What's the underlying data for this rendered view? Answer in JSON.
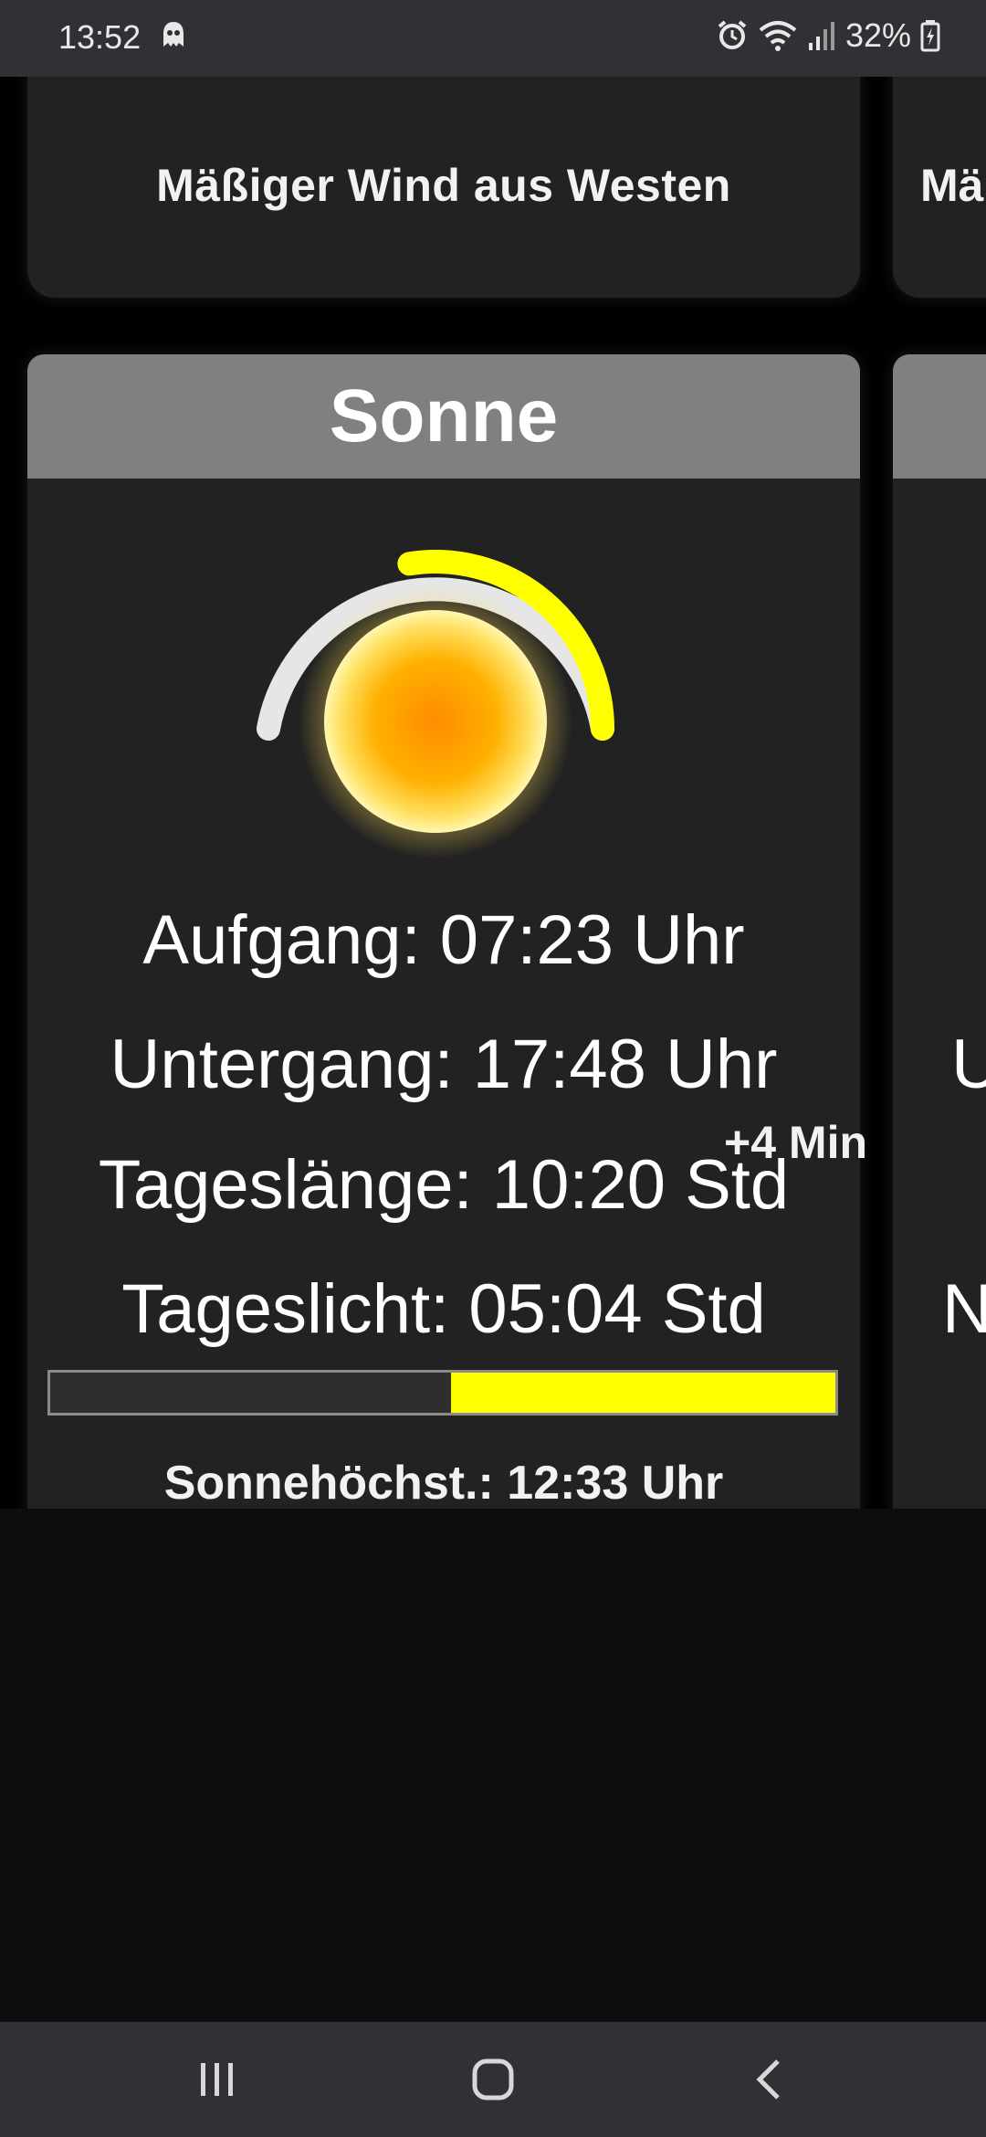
{
  "status_bar": {
    "time": "13:52",
    "battery": "32%"
  },
  "cards": {
    "wind": {
      "text": "Mäßiger Wind aus Westen",
      "peek_text": "Mä"
    },
    "sun": {
      "title": "Sonne",
      "sunrise": "Aufgang: 07:23 Uhr",
      "sunset": "Untergang: 17:48 Uhr",
      "delta": "+4 Min",
      "day_length": "Tageslänge: 10:20 Std",
      "daylight": "Tageslicht: 05:04 Std",
      "daylight_remaining_fraction": 0.49,
      "arc_progress_fraction": 0.45,
      "zenith": "Sonnehöchst.: 12:33 Uhr",
      "accent_color": "#ffff00",
      "peek_letters": [
        "U",
        "N"
      ]
    }
  },
  "nav_bar": {
    "icons": [
      "recent-apps-icon",
      "home-icon",
      "back-icon"
    ]
  }
}
